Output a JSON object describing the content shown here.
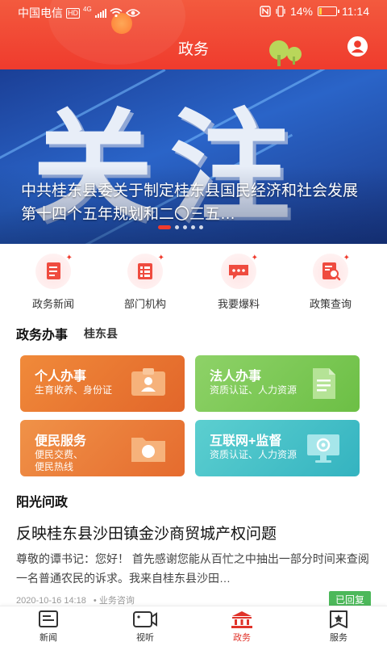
{
  "status_bar": {
    "carrier": "中国电信",
    "network_badge": "HD",
    "network_type": "4G",
    "battery_percent": "14%",
    "time": "11:14",
    "battery_level": 0.14
  },
  "header": {
    "title": "政务",
    "accent_color": "#ef3b2d"
  },
  "banner": {
    "headline_text": "关注",
    "caption": "中共桂东县委关于制定桂东县国民经济和社会发展 第十四个五年规划和二〇三五…",
    "slide_count": 5,
    "active_slide": 1
  },
  "quick_entries": [
    {
      "label": "政务新闻",
      "icon": "news-document-icon"
    },
    {
      "label": "部门机构",
      "icon": "department-list-icon"
    },
    {
      "label": "我要爆料",
      "icon": "chat-report-icon"
    },
    {
      "label": "政策查询",
      "icon": "policy-search-icon"
    }
  ],
  "affairs": {
    "title": "政务办事",
    "region": "桂东县",
    "cards": [
      {
        "title": "个人办事",
        "desc": "生育收养、身份证",
        "icon": "id-card-icon",
        "color": "#e8742f"
      },
      {
        "title": "法人办事",
        "desc": "资质认证、人力资源",
        "icon": "document-icon",
        "color": "#7bc856"
      },
      {
        "title": "便民服务",
        "desc": "便民交费、便民热线",
        "icon": "folder-compass-icon",
        "color": "#ea7a38"
      },
      {
        "title": "互联网+监督",
        "desc": "资质认证、人力资源",
        "icon": "monitor-icon",
        "color": "#45c0c8"
      }
    ]
  },
  "sunshine": {
    "title": "阳光问政",
    "item": {
      "title": "反映桂东县沙田镇金沙商贸城产权问题",
      "body": "尊敬的谭书记：您好！ 首先感谢您能从百忙之中抽出一部分时间来查阅一名普通农民的诉求。我来自桂东县沙田…",
      "date": "2020-10-16 14:18",
      "category": "• 业务咨询",
      "status": "已回复",
      "status_color": "#4cb85a"
    }
  },
  "bottom_nav": [
    {
      "label": "新闻",
      "icon": "news-icon",
      "active": false
    },
    {
      "label": "视听",
      "icon": "video-icon",
      "active": false
    },
    {
      "label": "政务",
      "icon": "government-building-icon",
      "active": true
    },
    {
      "label": "服务",
      "icon": "service-star-icon",
      "active": false
    }
  ]
}
